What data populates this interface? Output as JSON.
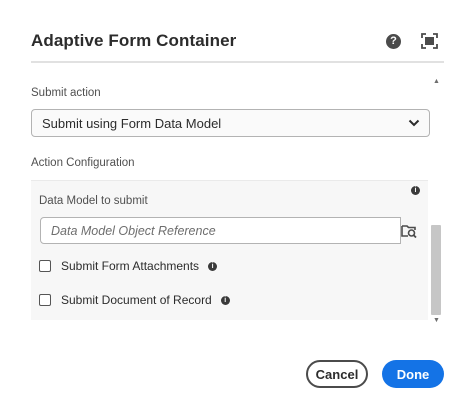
{
  "dialog": {
    "title": "Adaptive Form Container",
    "help_icon": "help-icon",
    "fullscreen_icon": "fullscreen-icon"
  },
  "submit": {
    "label": "Submit action",
    "selected": "Submit using Form Data Model"
  },
  "action": {
    "label": "Action Configuration",
    "data_model_label": "Data Model to submit",
    "input_placeholder": "Data Model Object Reference",
    "input_value": "",
    "checkboxes": [
      {
        "label": "Submit Form Attachments",
        "checked": false
      },
      {
        "label": "Submit Document of Record",
        "checked": false
      }
    ]
  },
  "footer": {
    "cancel": "Cancel",
    "done": "Done"
  },
  "colors": {
    "primary": "#1473e6",
    "text": "#2c2c2c"
  }
}
